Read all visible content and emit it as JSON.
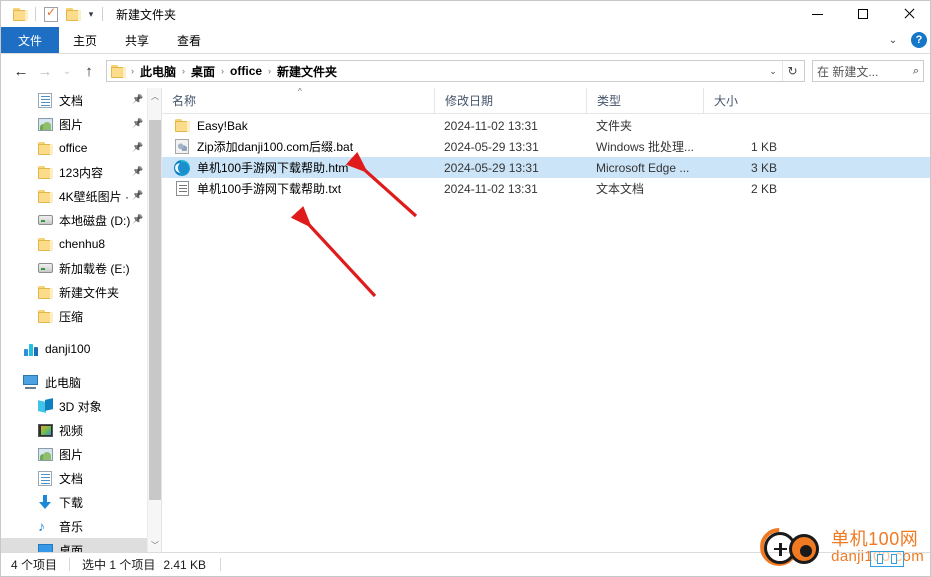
{
  "window": {
    "title": "新建文件夹",
    "quick_access": {
      "folder_icon": "folder-icon",
      "properties_icon": "properties-checkbox-icon",
      "new_folder_icon": "new-folder-icon",
      "customize_caret": "chevron-down-icon"
    },
    "controls": {
      "minimize": "minimize-icon",
      "maximize": "maximize-icon",
      "close": "close-icon"
    }
  },
  "ribbon": {
    "tabs": [
      {
        "label": "文件",
        "active": true
      },
      {
        "label": "主页",
        "active": false
      },
      {
        "label": "共享",
        "active": false
      },
      {
        "label": "查看",
        "active": false
      }
    ],
    "collapse_caret": "chevron-down-icon",
    "help": "?"
  },
  "addressbar": {
    "back_icon": "back-arrow-icon",
    "forward_icon": "forward-arrow-icon",
    "recent_caret": "chevron-down-icon",
    "up_icon": "up-arrow-icon",
    "folder_icon": "folder-icon",
    "crumbs": [
      "此电脑",
      "桌面",
      "office",
      "新建文件夹"
    ],
    "separator": "›",
    "dropdown_caret": "chevron-down-icon",
    "refresh_icon": "refresh-icon",
    "search": {
      "text": "在 新建文...",
      "placeholder": "在 新建文...",
      "icon": "search-icon"
    }
  },
  "navpane": {
    "scroll": {
      "up_icon": "chevron-up-icon",
      "down_icon": "chevron-down-icon"
    },
    "items": [
      {
        "label": "文档",
        "icon": "documents-icon",
        "indent": 1,
        "pinned": true,
        "selected": false
      },
      {
        "label": "图片",
        "icon": "pictures-icon",
        "indent": 1,
        "pinned": true,
        "selected": false
      },
      {
        "label": "office",
        "icon": "folder-icon",
        "indent": 1,
        "pinned": true,
        "selected": false
      },
      {
        "label": "123内容",
        "icon": "folder-icon",
        "indent": 1,
        "pinned": true,
        "selected": false
      },
      {
        "label": "4K壁纸图片 ·",
        "icon": "folder-icon",
        "indent": 1,
        "pinned": true,
        "selected": false
      },
      {
        "label": "本地磁盘 (D:)",
        "icon": "drive-icon",
        "indent": 1,
        "pinned": true,
        "selected": false
      },
      {
        "label": "chenhu8",
        "icon": "folder-icon",
        "indent": 1,
        "pinned": false,
        "selected": false
      },
      {
        "label": "新加载卷 (E:)",
        "icon": "drive-icon",
        "indent": 1,
        "pinned": false,
        "selected": false
      },
      {
        "label": "新建文件夹",
        "icon": "folder-icon",
        "indent": 1,
        "pinned": false,
        "selected": false
      },
      {
        "label": "压缩",
        "icon": "folder-icon",
        "indent": 1,
        "pinned": false,
        "selected": false
      },
      {
        "label": "",
        "icon": "gap",
        "indent": 0,
        "pinned": false,
        "selected": false
      },
      {
        "label": "danji100",
        "icon": "onedrive-icon",
        "indent": 0,
        "pinned": false,
        "selected": false
      },
      {
        "label": "",
        "icon": "gap",
        "indent": 0,
        "pinned": false,
        "selected": false
      },
      {
        "label": "此电脑",
        "icon": "this-pc-icon",
        "indent": 0,
        "pinned": false,
        "selected": false
      },
      {
        "label": "3D 对象",
        "icon": "3d-objects-icon",
        "indent": 1,
        "pinned": false,
        "selected": false
      },
      {
        "label": "视频",
        "icon": "videos-icon",
        "indent": 1,
        "pinned": false,
        "selected": false
      },
      {
        "label": "图片",
        "icon": "pictures-icon",
        "indent": 1,
        "pinned": false,
        "selected": false
      },
      {
        "label": "文档",
        "icon": "documents-icon",
        "indent": 1,
        "pinned": false,
        "selected": false
      },
      {
        "label": "下载",
        "icon": "downloads-icon",
        "indent": 1,
        "pinned": false,
        "selected": false
      },
      {
        "label": "音乐",
        "icon": "music-icon",
        "indent": 1,
        "pinned": false,
        "selected": false
      },
      {
        "label": "桌面",
        "icon": "desktop-icon",
        "indent": 1,
        "pinned": false,
        "selected": true
      }
    ]
  },
  "filelist": {
    "columns": [
      {
        "label": "名称",
        "key": "name",
        "sorted": true
      },
      {
        "label": "修改日期",
        "key": "date",
        "sorted": false
      },
      {
        "label": "类型",
        "key": "type",
        "sorted": false
      },
      {
        "label": "大小",
        "key": "size",
        "sorted": false
      }
    ],
    "sort_indicator": "^",
    "rows": [
      {
        "name": "Easy!Bak",
        "icon": "folder-icon",
        "date": "2024-11-02 13:31",
        "type": "文件夹",
        "size": "",
        "selected": false
      },
      {
        "name": "Zip添加danji100.com后缀.bat",
        "icon": "bat-file-icon",
        "date": "2024-05-29 13:31",
        "type": "Windows 批处理...",
        "size": "1 KB",
        "selected": false
      },
      {
        "name": "单机100手游网下载帮助.htm",
        "icon": "edge-html-icon",
        "date": "2024-05-29 13:31",
        "type": "Microsoft Edge ...",
        "size": "3 KB",
        "selected": true
      },
      {
        "name": "单机100手游网下载帮助.txt",
        "icon": "text-file-icon",
        "date": "2024-11-02 13:31",
        "type": "文本文档",
        "size": "2 KB",
        "selected": false
      }
    ]
  },
  "annotations": {
    "arrow_color": "#e01b1b",
    "arrows": [
      {
        "name": "arrow-pointing-to-htm-row"
      },
      {
        "name": "arrow-pointing-to-txt-row"
      }
    ]
  },
  "statusbar": {
    "item_count": "4 个项目",
    "selection": "选中 1 个项目",
    "selection_size": "2.41 KB"
  },
  "watermark": {
    "title": "单机100网",
    "subtitle": "danji100.com",
    "color": "#f07a22"
  }
}
